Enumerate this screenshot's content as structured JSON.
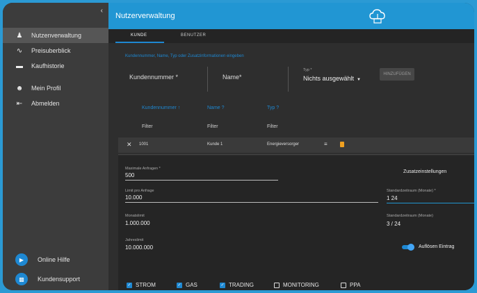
{
  "sidebar": {
    "collapse_glyph": "‹",
    "items": [
      {
        "label": "Nutzenverwaltung",
        "icon": "users-icon"
      },
      {
        "label": "Preisuberblick",
        "icon": "trend-icon"
      },
      {
        "label": "Kaufhistorie",
        "icon": "card-icon"
      },
      {
        "label": "Mein Profil",
        "icon": "person-icon"
      },
      {
        "label": "Abmelden",
        "icon": "logout-icon"
      }
    ],
    "bottom": [
      {
        "label": "Online Hilfe",
        "icon": "video-icon"
      },
      {
        "label": "Kundensupport",
        "icon": "chat-icon"
      }
    ]
  },
  "header": {
    "title": "Nutzerverwaltung",
    "logo_icon": "cloud-logo-icon"
  },
  "tabs": [
    {
      "label": "KUNDE"
    },
    {
      "label": "BENUTZER"
    }
  ],
  "search": {
    "hint": "Kundennummer, Name, Typ oder Zusatzinformationen eingeben",
    "kundennummer": "Kundennummer *",
    "name": "Name*",
    "typ_label": "Typ *",
    "typ_value": "Nichts ausgewählt",
    "button": "HINZUFÜGEN"
  },
  "table": {
    "headers": [
      "Kundennummer",
      "Name",
      "Typ"
    ],
    "filters": [
      "Filter",
      "Filter",
      "Filter"
    ],
    "row": {
      "nr": "1001",
      "name": "Kunde 1",
      "typ": "Energieversorger"
    }
  },
  "form": {
    "left": [
      {
        "label": "Maximale Anfragen *",
        "value": "500"
      },
      {
        "label": "Limit pro Anfrage",
        "value": "10.000"
      },
      {
        "label": "Monatslimit",
        "value": "1.000.000"
      },
      {
        "label": "Jahreslimit",
        "value": "10.000.000"
      }
    ],
    "zusatz": "Zusatzeinstellungen",
    "right": [
      {
        "label": "Standardzeitraum (Monate) *",
        "value": "1 24"
      },
      {
        "label": "Standardzeitraum (Monate)",
        "value": "3 / 24"
      }
    ],
    "toggle_label": "Auflösen Eintrag",
    "checkboxes": [
      {
        "label": "STROM",
        "checked": true
      },
      {
        "label": "GAS",
        "checked": true
      },
      {
        "label": "TRADING",
        "checked": true
      },
      {
        "label": "MONITORING",
        "checked": false
      },
      {
        "label": "PPA",
        "checked": false
      }
    ]
  }
}
